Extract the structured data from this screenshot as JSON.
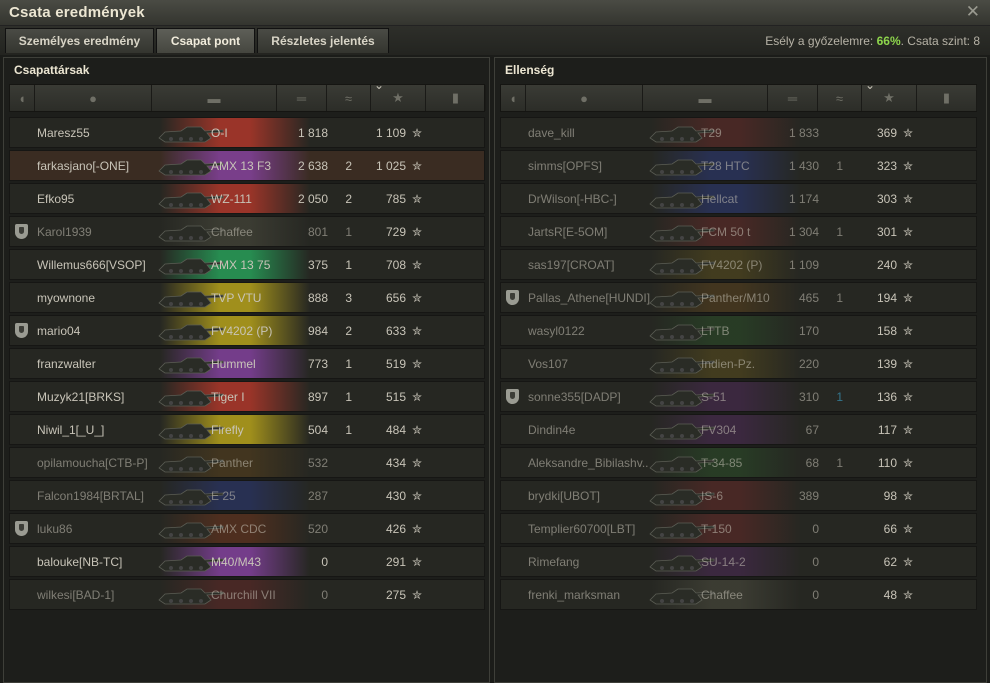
{
  "window": {
    "title": "Csata eredmények",
    "close_label": "✕"
  },
  "tabs": [
    {
      "label": "Személyes eredmény",
      "active": false
    },
    {
      "label": "Csapat pont",
      "active": true
    },
    {
      "label": "Részletes jelentés",
      "active": false
    }
  ],
  "odds": {
    "prefix": "Esély a győzelemre: ",
    "value": "66%",
    "suffix": ". Csata szint: 8"
  },
  "colors": {
    "accent_green": "#8ed64c",
    "kills_blue": "#3fb7e6",
    "text": "#c8c4b8",
    "dead_text": "#7b776e"
  },
  "header_icons": [
    "platoon-icon",
    "player-icon",
    "tank-icon",
    "damage-icon",
    "kills-icon",
    "score-icon",
    "medal-icon"
  ],
  "allies": {
    "title": "Csapattársak",
    "rows": [
      {
        "name": "Maresz55",
        "tank": "O-I",
        "damage": "1 818",
        "kills": "",
        "score": "1 109",
        "platoon": false,
        "alive": true,
        "hl": false,
        "color": "#c0392b"
      },
      {
        "name": "farkasjano[-ONE]",
        "tank": "AMX 13 F3",
        "damage": "2 638",
        "kills": "2",
        "score": "1 025",
        "platoon": false,
        "alive": true,
        "hl": true,
        "color": "#8e44ad"
      },
      {
        "name": "Efko95",
        "tank": "WZ-111",
        "damage": "2 050",
        "kills": "2",
        "score": "785",
        "platoon": false,
        "alive": true,
        "hl": false,
        "color": "#c0392b"
      },
      {
        "name": "Karol1939",
        "tank": "Chaffee",
        "damage": "801",
        "kills": "1",
        "score": "729",
        "platoon": true,
        "alive": false,
        "hl": false,
        "color": "#5a5a4a"
      },
      {
        "name": "Willemus666[VSOP]",
        "tank": "AMX 13 75",
        "damage": "375",
        "kills": "1",
        "score": "708",
        "platoon": false,
        "alive": true,
        "hl": false,
        "color": "#27ae60"
      },
      {
        "name": "myownone",
        "tank": "TVP VTU",
        "damage": "888",
        "kills": "3",
        "score": "656",
        "platoon": false,
        "alive": true,
        "hl": false,
        "color": "#c9b21a"
      },
      {
        "name": "mario04",
        "tank": "FV4202 (P)",
        "damage": "984",
        "kills": "2",
        "score": "633",
        "platoon": true,
        "alive": true,
        "hl": false,
        "color": "#c9b21a"
      },
      {
        "name": "franzwalter",
        "tank": "Hummel",
        "damage": "773",
        "kills": "1",
        "score": "519",
        "platoon": false,
        "alive": true,
        "hl": false,
        "color": "#8e44ad"
      },
      {
        "name": "Muzyk21[BRKS]",
        "tank": "Tiger I",
        "damage": "897",
        "kills": "1",
        "score": "515",
        "platoon": false,
        "alive": true,
        "hl": false,
        "color": "#c0392b"
      },
      {
        "name": "Niwil_1[_U_]",
        "tank": "Firefly",
        "damage": "504",
        "kills": "1",
        "score": "484",
        "platoon": false,
        "alive": true,
        "hl": false,
        "color": "#c9b21a"
      },
      {
        "name": "opilamoucha[CTB-P]",
        "tank": "Panther",
        "damage": "532",
        "kills": "",
        "score": "434",
        "platoon": false,
        "alive": false,
        "hl": false,
        "color": "#6b4a1a"
      },
      {
        "name": "Falcon1984[BRTAL]",
        "tank": "E 25",
        "damage": "287",
        "kills": "",
        "score": "430",
        "platoon": false,
        "alive": false,
        "hl": false,
        "color": "#2c3e9a"
      },
      {
        "name": "luku86",
        "tank": "AMX CDC",
        "damage": "520",
        "kills": "",
        "score": "426",
        "platoon": true,
        "alive": false,
        "hl": false,
        "color": "#8a3a1a"
      },
      {
        "name": "balouke[NB-TC]",
        "tank": "M40/M43",
        "damage": "0",
        "kills": "",
        "score": "291",
        "platoon": false,
        "alive": true,
        "hl": false,
        "color": "#8e44ad"
      },
      {
        "name": "wilkesi[BAD-1]",
        "tank": "Churchill VII",
        "damage": "0",
        "kills": "",
        "score": "275",
        "platoon": false,
        "alive": false,
        "hl": false,
        "color": "#7a2a2a"
      }
    ]
  },
  "enemies": {
    "title": "Ellenség",
    "rows": [
      {
        "name": "dave_kill",
        "tank": "T29",
        "damage": "1 833",
        "kills": "",
        "score": "369",
        "platoon": false,
        "alive": false,
        "hl": false,
        "color": "#7a2a2a"
      },
      {
        "name": "simms[OPFS]",
        "tank": "T28 HTC",
        "damage": "1 430",
        "kills": "1",
        "score": "323",
        "platoon": false,
        "alive": false,
        "hl": false,
        "color": "#2c3e9a"
      },
      {
        "name": "DrWilson[-HBC-]",
        "tank": "Hellcat",
        "damage": "1 174",
        "kills": "",
        "score": "303",
        "platoon": false,
        "alive": false,
        "hl": false,
        "color": "#2c3e9a"
      },
      {
        "name": "JartsR[E-5OM]",
        "tank": "FCM 50 t",
        "damage": "1 304",
        "kills": "1",
        "score": "301",
        "platoon": false,
        "alive": false,
        "hl": false,
        "color": "#7a2a2a"
      },
      {
        "name": "sas197[CROAT]",
        "tank": "FV4202 (P)",
        "damage": "1 109",
        "kills": "",
        "score": "240",
        "platoon": false,
        "alive": false,
        "hl": false,
        "color": "#6b5a1a"
      },
      {
        "name": "Pallas_Athene[HUNDI]",
        "tank": "Panther/M10",
        "damage": "465",
        "kills": "1",
        "score": "194",
        "platoon": true,
        "alive": false,
        "hl": false,
        "color": "#6b4a1a"
      },
      {
        "name": "wasyl0122",
        "tank": "LTTB",
        "damage": "170",
        "kills": "",
        "score": "158",
        "platoon": false,
        "alive": false,
        "hl": false,
        "color": "#2a5a2a"
      },
      {
        "name": "Vos107",
        "tank": "Indien-Pz.",
        "damage": "220",
        "kills": "",
        "score": "139",
        "platoon": false,
        "alive": false,
        "hl": false,
        "color": "#6b5a1a"
      },
      {
        "name": "sonne355[DADP]",
        "tank": "S-51",
        "damage": "310",
        "kills": "1",
        "score": "136",
        "platoon": true,
        "alive": false,
        "hl": false,
        "color": "#5a2a6a"
      },
      {
        "name": "Dindin4e",
        "tank": "FV304",
        "damage": "67",
        "kills": "",
        "score": "117",
        "platoon": false,
        "alive": false,
        "hl": false,
        "color": "#5a2a6a"
      },
      {
        "name": "Aleksandre_Bibilashv..",
        "tank": "T-34-85",
        "damage": "68",
        "kills": "1",
        "score": "110",
        "platoon": false,
        "alive": false,
        "hl": false,
        "color": "#2a5a2a"
      },
      {
        "name": "brydki[UBOT]",
        "tank": "IS-6",
        "damage": "389",
        "kills": "",
        "score": "98",
        "platoon": false,
        "alive": false,
        "hl": false,
        "color": "#7a2a2a"
      },
      {
        "name": "Templier60700[LBT]",
        "tank": "T-150",
        "damage": "0",
        "kills": "",
        "score": "66",
        "platoon": false,
        "alive": false,
        "hl": false,
        "color": "#7a2a2a"
      },
      {
        "name": "Rimefang",
        "tank": "SU-14-2",
        "damage": "0",
        "kills": "",
        "score": "62",
        "platoon": false,
        "alive": false,
        "hl": false,
        "color": "#5a2a6a"
      },
      {
        "name": "frenki_marksman",
        "tank": "Chaffee",
        "damage": "0",
        "kills": "",
        "score": "48",
        "platoon": false,
        "alive": false,
        "hl": false,
        "color": "#5a5a4a"
      }
    ]
  },
  "star_glyph": "✮"
}
